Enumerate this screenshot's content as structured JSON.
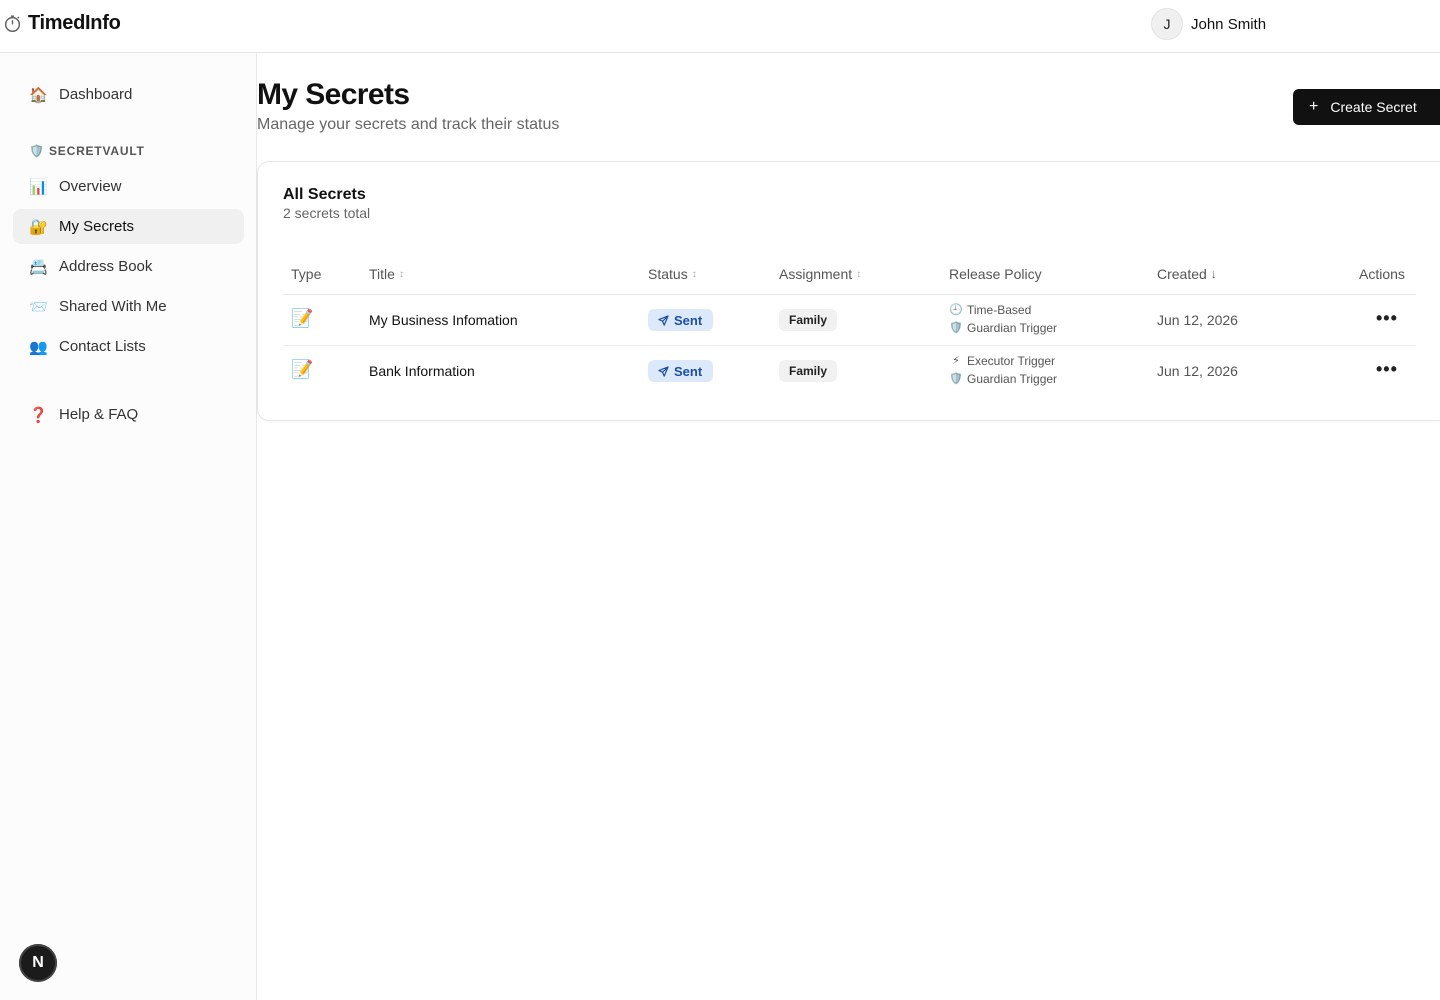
{
  "app": {
    "name": "TimedInfo"
  },
  "user": {
    "initial": "J",
    "name": "John Smith"
  },
  "sidebar": {
    "dashboard": {
      "label": "Dashboard",
      "icon": "🏠"
    },
    "section": {
      "label": "SECRETVAULT",
      "icon": "🛡️"
    },
    "items": [
      {
        "label": "Overview",
        "icon": "📊"
      },
      {
        "label": "My Secrets",
        "icon": "🔐"
      },
      {
        "label": "Address Book",
        "icon": "📇"
      },
      {
        "label": "Shared With Me",
        "icon": "📨"
      },
      {
        "label": "Contact Lists",
        "icon": "👥"
      }
    ],
    "help": {
      "label": "Help & FAQ",
      "icon": "❓"
    },
    "badge": "N"
  },
  "main": {
    "title": "My Secrets",
    "subtitle": "Manage your secrets and track their status",
    "create_button": "Create Secret",
    "create_icon": "+"
  },
  "card": {
    "title": "All Secrets",
    "subtitle": "2 secrets total",
    "columns": {
      "type": "Type",
      "title": "Title",
      "status": "Status",
      "assignment": "Assignment",
      "policy": "Release Policy",
      "created": "Created",
      "actions": "Actions"
    },
    "rows": [
      {
        "type_icon": "📝",
        "title": "My Business Infomation",
        "status": "Sent",
        "assignment": "Family",
        "policy_1": "Time-Based",
        "policy_1_icon": "🕘",
        "policy_2": "Guardian Trigger",
        "policy_2_icon": "🛡️",
        "created": "Jun 12, 2026",
        "actions": "•••"
      },
      {
        "type_icon": "📝",
        "title": "Bank Information",
        "status": "Sent",
        "assignment": "Family",
        "policy_1": "Executor Trigger",
        "policy_1_icon": "⚡",
        "policy_2": "Guardian Trigger",
        "policy_2_icon": "🛡️",
        "created": "Jun 12, 2026",
        "actions": "•••"
      }
    ]
  },
  "colors": {
    "accent": "#111111",
    "status_bg": "#dbe9fb",
    "status_text": "#1c4fa5"
  }
}
